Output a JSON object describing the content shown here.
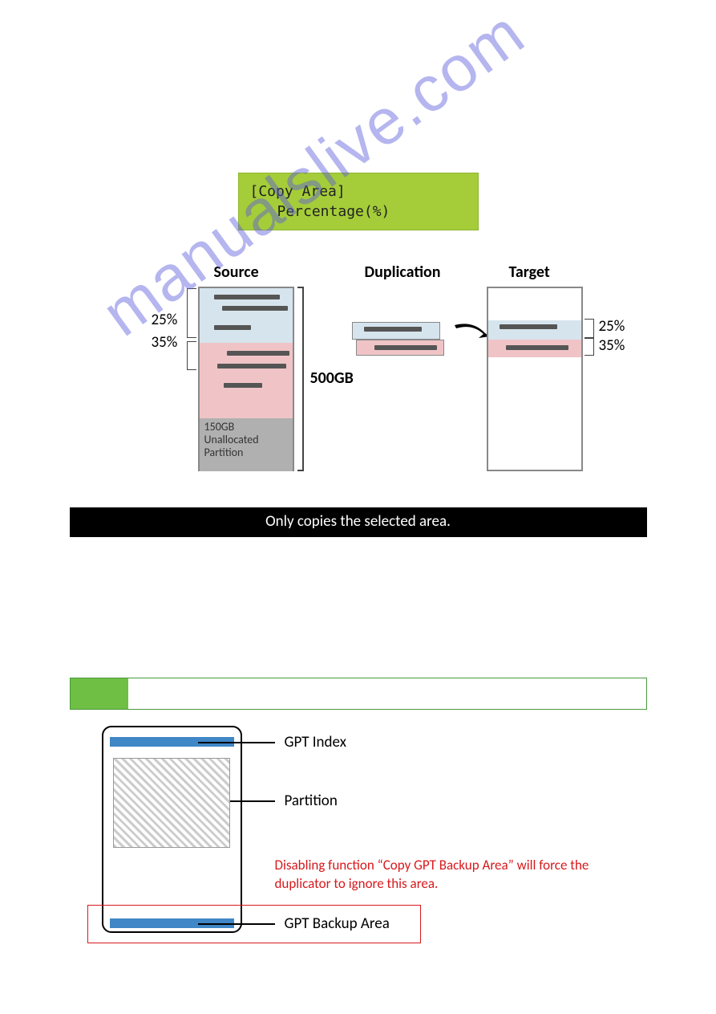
{
  "lcd": {
    "line1": "[Copy Area]",
    "line2": "Percentage(%)"
  },
  "diagram1": {
    "labels": {
      "source": "Source",
      "duplication": "Duplication",
      "target": "Target"
    },
    "source": {
      "pct1": "25%",
      "pct2": "35%",
      "capacity": "500GB",
      "unalloc_line1": "150GB",
      "unalloc_line2": "Unallocated",
      "unalloc_line3": "Partition"
    },
    "target": {
      "pct1": "25%",
      "pct2": "35%"
    },
    "caption": "Only copies the selected area."
  },
  "diagram2": {
    "gpt_index": "GPT Index",
    "partition": "Partition",
    "gpt_backup": "GPT Backup Area",
    "note": "Disabling function “Copy GPT Backup Area” will force the duplicator to ignore this area."
  },
  "watermark": "manualslive.com"
}
